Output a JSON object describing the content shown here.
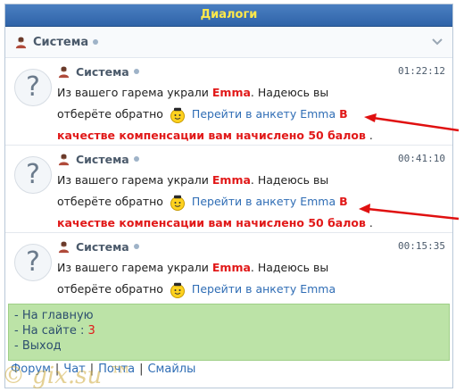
{
  "header": {
    "title": "Диалоги"
  },
  "dialog": {
    "contact": "Система"
  },
  "messages": [
    {
      "sender": "Система",
      "time": "01:22:12",
      "text_start": "Из вашего гарема украли",
      "name": "Emma",
      "text_mid": ". Надеюсь вы отберёте обратно",
      "link": "Перейти в анкету Emma",
      "bonus": "В качестве компенсации вам начислено 50 балов",
      "end": "."
    },
    {
      "sender": "Система",
      "time": "00:41:10",
      "text_start": "Из вашего гарема украли",
      "name": "Emma",
      "text_mid": ". Надеюсь вы отберёте обратно",
      "link": "Перейти в анкету Emma",
      "bonus": "В качестве компенсации вам начислено 50 балов",
      "end": "."
    },
    {
      "sender": "Система",
      "time": "00:15:35",
      "text_start": "Из вашего гарема украли",
      "name": "Emma",
      "text_mid": ". Надеюсь вы отберёте обратно",
      "link": "Перейти в анкету Emma"
    }
  ],
  "menu": {
    "home": "- На главную",
    "online_label": "- На сайте :",
    "online_count": "3",
    "exit": "- Выход"
  },
  "footer": {
    "forum": "Форум",
    "chat": "Чат",
    "mail": "Почта",
    "smiles": "Смайлы",
    "sep": "|"
  },
  "watermark": "© gix.su ™",
  "colors": {
    "title_bg": "#2f63a8",
    "title_text": "#ffe94a",
    "accent_red": "#e11919",
    "link": "#2f6db5",
    "menu_bg": "#bce3a7"
  },
  "icons": {
    "avatar": "user-avatar-icon",
    "status": "status-dot-icon",
    "chevron": "chevron-down-icon",
    "smile": "smile-icon",
    "placeholder": "question-avatar-icon"
  }
}
